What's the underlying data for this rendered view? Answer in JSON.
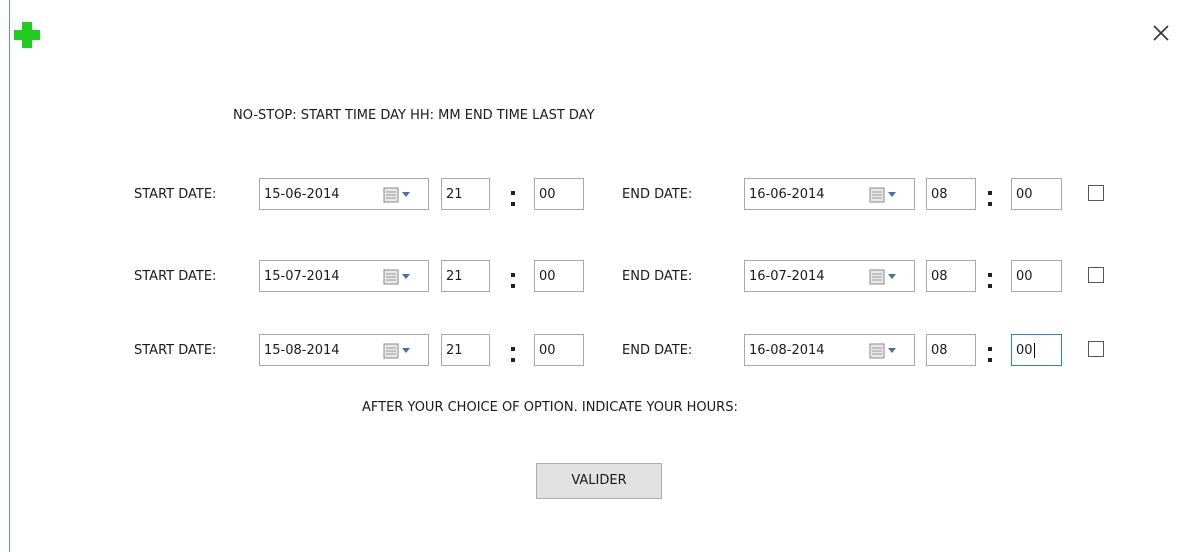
{
  "window": {
    "close_icon": "close-icon",
    "app_icon": "green-cross-icon",
    "app_icon_color": "#22cc22",
    "border_color": "#5b8fd0"
  },
  "title": "NO-STOP: START TIME DAY HH: MM END TIME LAST DAY",
  "rows": [
    {
      "start_label": "START DATE:",
      "start_date": "15-06-2014",
      "start_hour": "21",
      "start_minute": "00",
      "end_label": "END DATE:",
      "end_date": "16-06-2014",
      "end_hour": "08",
      "end_minute": "00",
      "checked": false
    },
    {
      "start_label": "START DATE:",
      "start_date": "15-07-2014",
      "start_hour": "21",
      "start_minute": "00",
      "end_label": "END DATE:",
      "end_date": "16-07-2014",
      "end_hour": "08",
      "end_minute": "00",
      "checked": false
    },
    {
      "start_label": "START DATE:",
      "start_date": "15-08-2014",
      "start_hour": "21",
      "start_minute": "00",
      "end_label": "END DATE:",
      "end_date": "16-08-2014",
      "end_hour": "08",
      "end_minute": "00",
      "checked": false
    }
  ],
  "hint": "AFTER YOUR CHOICE OF OPTION. INDICATE YOUR HOURS:",
  "submit_label": "VALIDER",
  "focus_color": "#2d7dd6"
}
